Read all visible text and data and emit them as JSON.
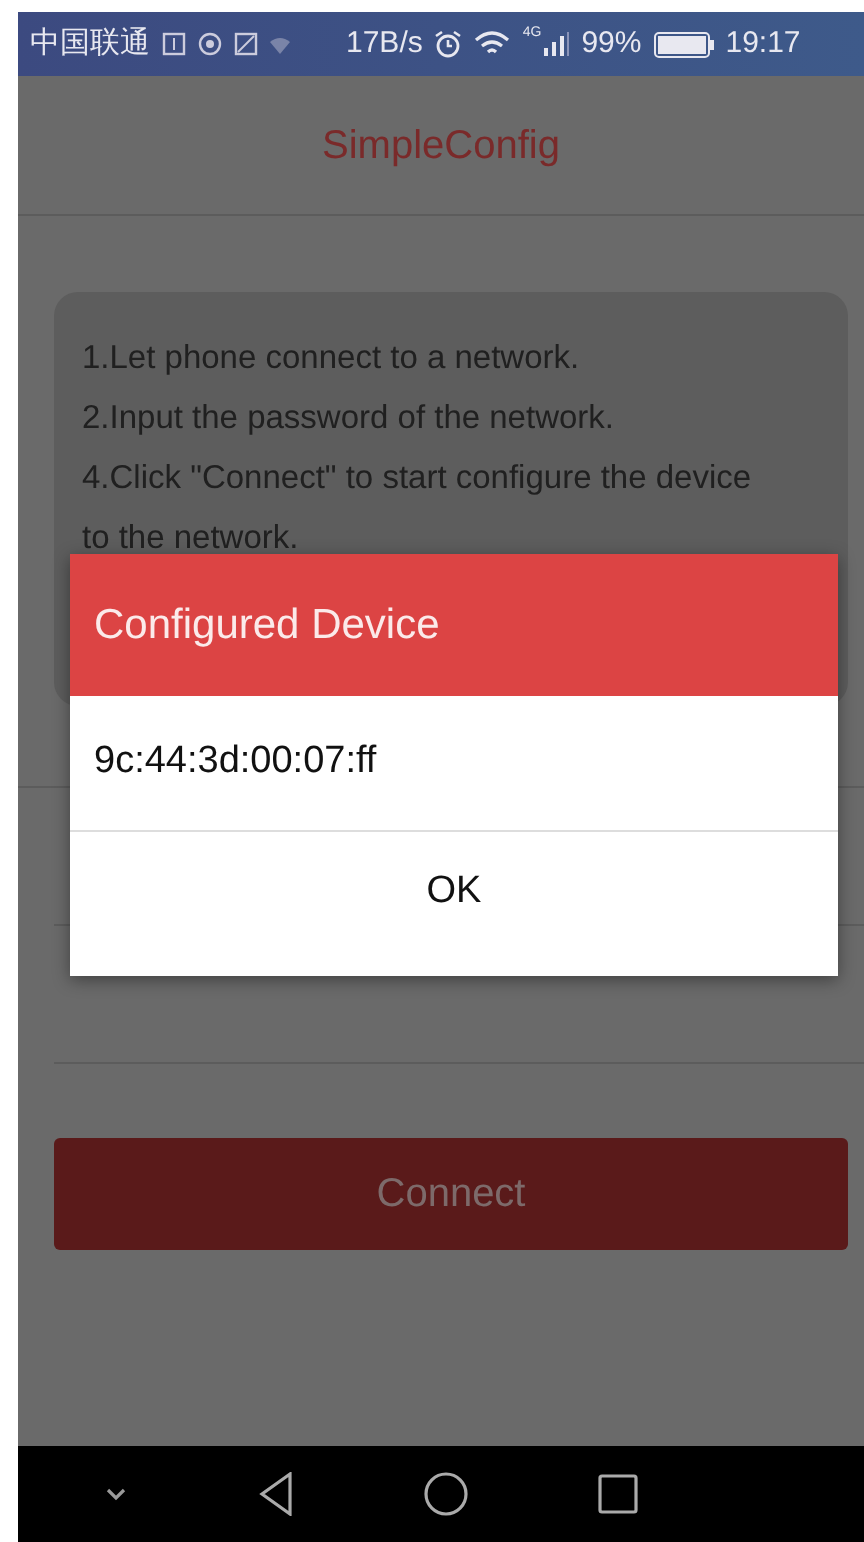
{
  "status_bar": {
    "carrier": "中国联通",
    "speed": "17B/s",
    "network": "4G",
    "battery": "99%",
    "time": "19:17"
  },
  "app_bar": {
    "title": "SimpleConfig"
  },
  "instructions": [
    "1.Let phone connect to a network.",
    "2.Input the password of the network.",
    "4.Click \"Connect\" to start configure the device to the network."
  ],
  "connect_button": "Connect",
  "dialog": {
    "title": "Configured Device",
    "message": "9c:44:3d:00:07:ff",
    "button": "OK"
  }
}
